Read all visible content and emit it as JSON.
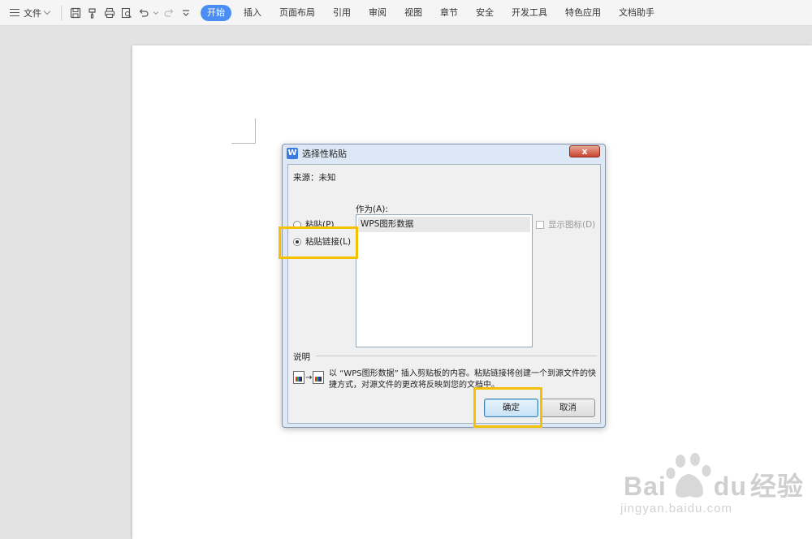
{
  "toolbar": {
    "file_label": "文件",
    "tabs": [
      "开始",
      "插入",
      "页面布局",
      "引用",
      "审阅",
      "视图",
      "章节",
      "安全",
      "开发工具",
      "特色应用",
      "文档助手"
    ]
  },
  "dialog": {
    "title": "选择性粘贴",
    "close_symbol": "x",
    "source": "来源：未知",
    "options": {
      "paste": "粘贴(P)",
      "paste_link": "粘贴链接(L)"
    },
    "as_label": "作为(A):",
    "list_items": [
      "WPS图形数据"
    ],
    "show_icon": "显示图标(D)",
    "description_label": "说明",
    "description_text": "以 “WPS图形数据” 插入剪贴板的内容。粘贴链接将创建一个到源文件的快捷方式，对源文件的更改将反映到您的文档中。",
    "ok": "确定",
    "cancel": "取消"
  },
  "watermark": {
    "brand": "Bai",
    "brand_suffix": "du",
    "brand_cn": "经验",
    "url": "jingyan.baidu.com"
  },
  "colors": {
    "accent": "#4a8ef5",
    "highlight": "#f5c000",
    "close": "#c9442c"
  }
}
